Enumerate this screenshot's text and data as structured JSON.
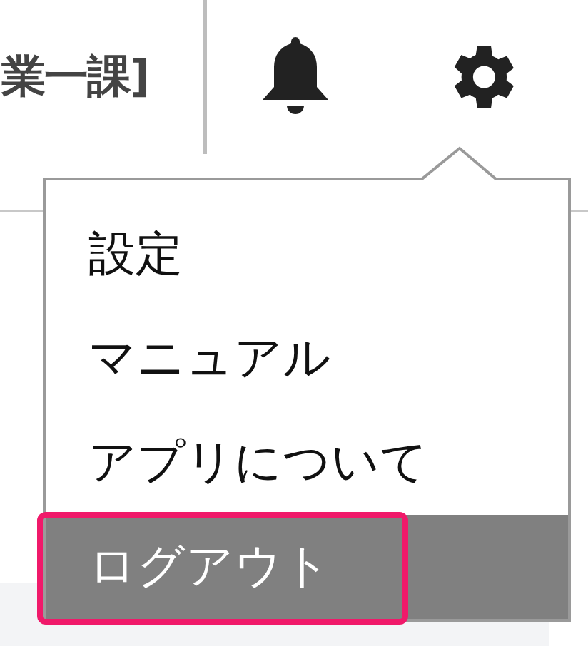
{
  "header": {
    "title": "業一課]"
  },
  "menu": {
    "items": [
      {
        "label": "設定",
        "selected": false,
        "highlighted": false
      },
      {
        "label": "マニュアル",
        "selected": false,
        "highlighted": false
      },
      {
        "label": "アプリについて",
        "selected": false,
        "highlighted": false
      },
      {
        "label": "ログアウト",
        "selected": true,
        "highlighted": true
      }
    ]
  }
}
